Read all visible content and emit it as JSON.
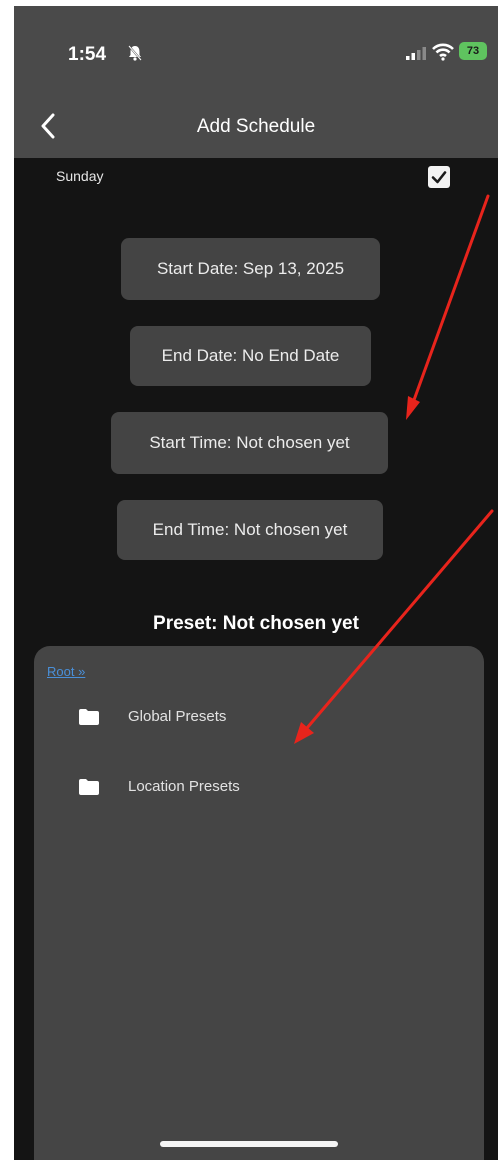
{
  "status_bar": {
    "time": "1:54",
    "battery": "73",
    "icons": [
      "bell-icon",
      "signal-icon",
      "wifi-icon",
      "battery-icon"
    ]
  },
  "nav": {
    "title": "Add Schedule",
    "back_icon": "chevron-left-icon"
  },
  "day": {
    "label": "Sunday",
    "checked": true
  },
  "buttons": {
    "start_date": "Start Date: Sep 13, 2025",
    "end_date": "End Date: No End Date",
    "start_time": "Start Time: Not chosen yet",
    "end_time": "End Time: Not chosen yet"
  },
  "preset": {
    "label": "Preset: Not chosen yet"
  },
  "browser": {
    "breadcrumb": "Root »",
    "folders": [
      {
        "name": "Global Presets",
        "icon": "folder-icon"
      },
      {
        "name": "Location Presets",
        "icon": "folder-icon"
      }
    ]
  },
  "annotations": {
    "arrow_color": "#e8241c"
  }
}
